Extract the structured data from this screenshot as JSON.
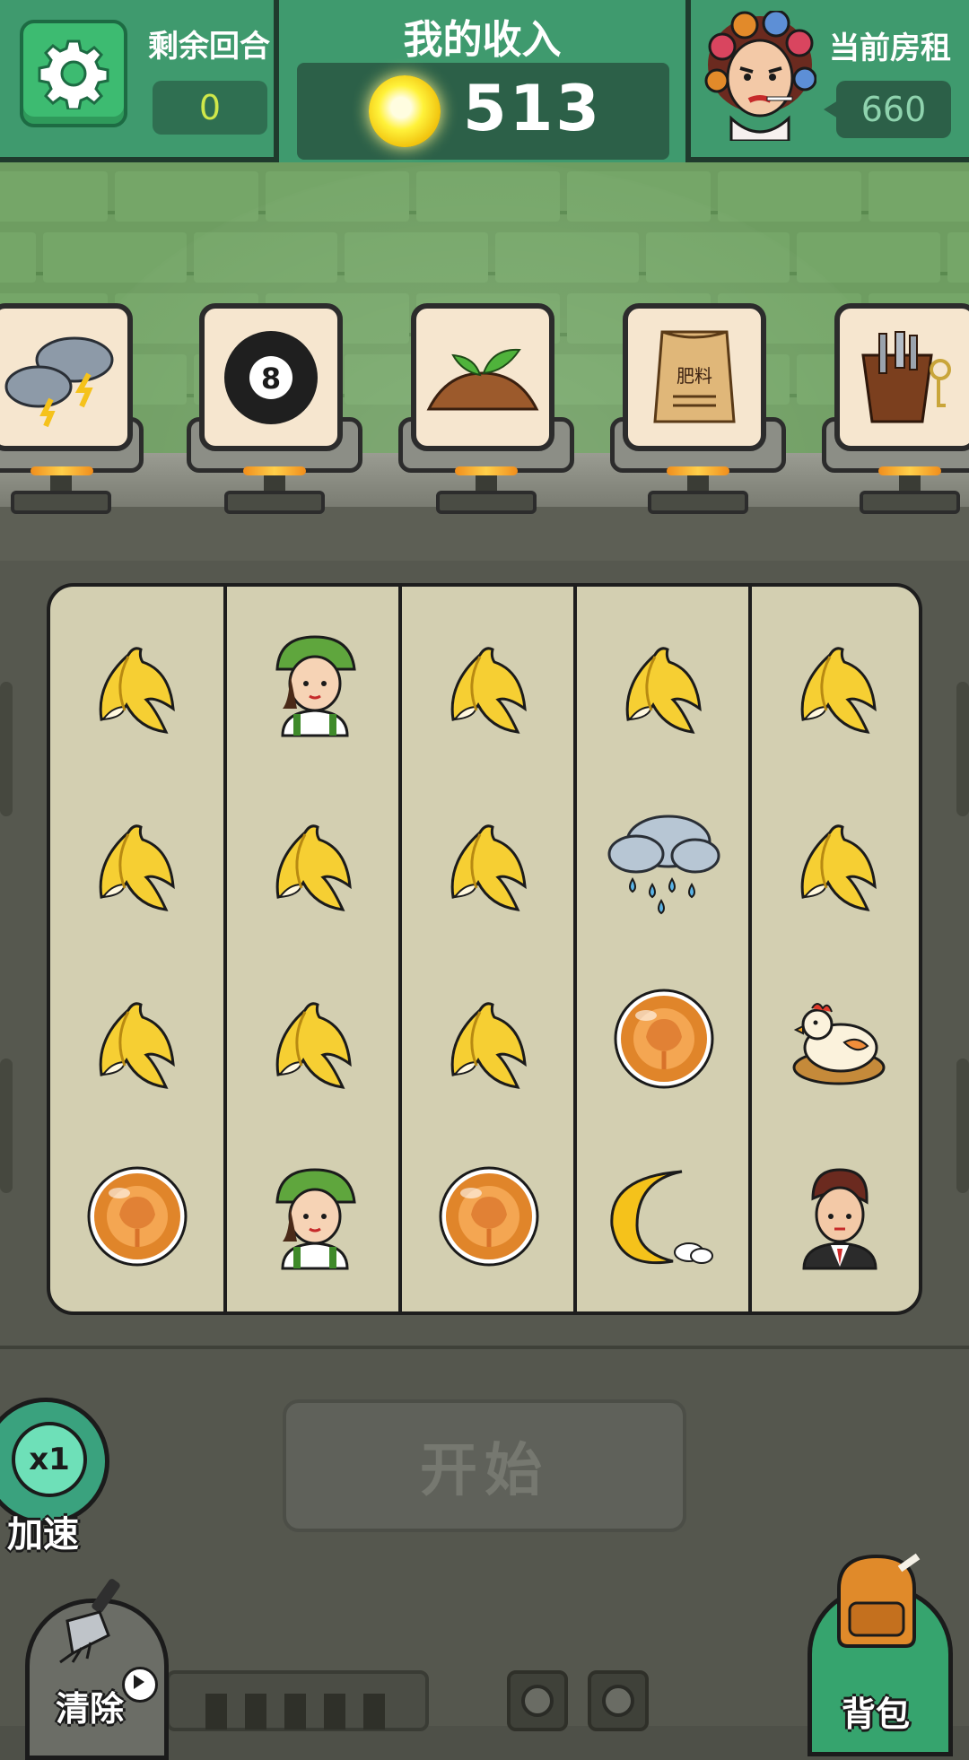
{
  "header": {
    "rounds_label": "剩余回合",
    "rounds_value": "0",
    "income_title": "我的收入",
    "income_value": "513",
    "rent_label": "当前房租",
    "rent_value": "660"
  },
  "shelf_items": [
    {
      "icon": "storm-cloud-icon"
    },
    {
      "icon": "eight-ball-icon",
      "text": "8"
    },
    {
      "icon": "sprout-soil-icon"
    },
    {
      "icon": "fertilizer-bag-icon",
      "text": "肥料"
    },
    {
      "icon": "tool-belt-icon"
    }
  ],
  "reels": [
    [
      "banana-peel-icon",
      "banana-peel-icon",
      "banana-peel-icon",
      "amber-orb-icon"
    ],
    [
      "farmer-girl-icon",
      "banana-peel-icon",
      "banana-peel-icon",
      "farmer-girl-icon"
    ],
    [
      "banana-peel-icon",
      "banana-peel-icon",
      "banana-peel-icon",
      "amber-orb-icon"
    ],
    [
      "banana-peel-icon",
      "rain-cloud-icon",
      "amber-orb-icon",
      "crescent-moon-icon"
    ],
    [
      "banana-peel-icon",
      "banana-peel-icon",
      "hen-nest-icon",
      "businessman-icon"
    ]
  ],
  "controls": {
    "start_label": "开始",
    "speed_value": "x1",
    "speed_label": "加速",
    "clear_label": "清除",
    "bag_label": "背包"
  },
  "colors": {
    "topbar": "#3f9a6e",
    "wall": "#6e9d61",
    "reel_bg": "#d3cfb1",
    "accent_green": "#3dbb71"
  }
}
